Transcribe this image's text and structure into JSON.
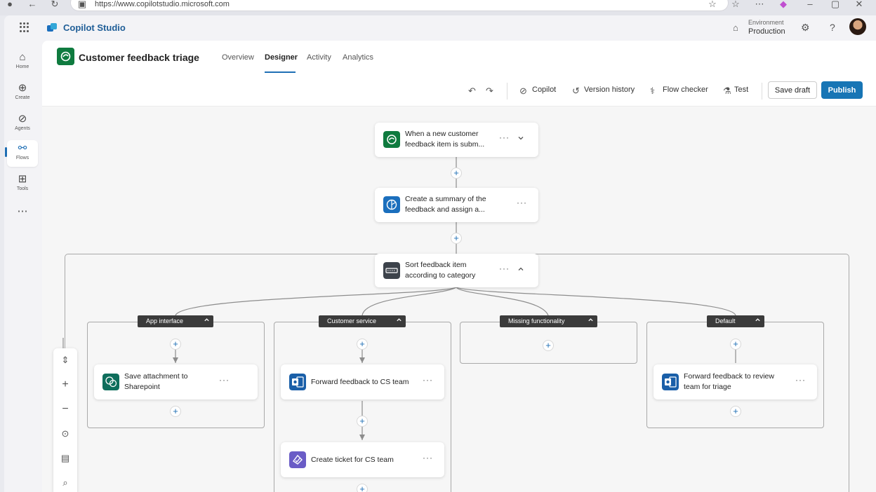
{
  "browser": {
    "url": "https://www.copilotstudio.microsoft.com",
    "icons": [
      "profile-icon",
      "back-icon",
      "refresh-icon",
      "site-info-icon",
      "favorite-add-icon",
      "favorites-icon",
      "more-icon",
      "copilot-icon",
      "minimize-icon",
      "maximize-icon",
      "close-icon"
    ]
  },
  "app": {
    "name": "Copilot Studio",
    "environment_label": "Environment",
    "environment_value": "Production"
  },
  "rail": {
    "items": [
      {
        "label": "Home",
        "icon": "home-icon"
      },
      {
        "label": "Create",
        "icon": "create-icon"
      },
      {
        "label": "Agents",
        "icon": "agents-icon"
      },
      {
        "label": "Flows",
        "icon": "flows-icon",
        "active": true
      },
      {
        "label": "Tools",
        "icon": "tools-icon"
      }
    ],
    "more": "⋯"
  },
  "flow": {
    "title": "Customer feedback triage",
    "tabs": [
      "Overview",
      "Designer",
      "Activity",
      "Analytics"
    ],
    "active_tab": "Designer"
  },
  "toolbar": {
    "copilot": "Copilot",
    "version_history": "Version history",
    "flow_checker": "Flow checker",
    "test": "Test",
    "save_draft": "Save draft",
    "publish": "Publish",
    "accent": "#1775b5"
  },
  "nodes": {
    "trigger": {
      "line1": "When a new customer",
      "line2": "feedback item is subm...",
      "color": "#0f7b3f"
    },
    "summary": {
      "line1": "Create a summary of the",
      "line2": "feedback and assign a...",
      "color": "#1b6fbd"
    },
    "sort": {
      "line1": "Sort feedback item",
      "line2": "according to category",
      "color": "#3d434b"
    }
  },
  "branches": [
    {
      "name": "App interface",
      "actions": [
        {
          "line1": "Save attachment to",
          "line2": "Sharepoint",
          "color": "#0e6e5c"
        }
      ]
    },
    {
      "name": "Customer service",
      "actions": [
        {
          "line1": "Forward feedback to CS team",
          "color": "#1a5fa8"
        },
        {
          "line1": "Create ticket for CS team",
          "color": "#6a5cc6"
        }
      ]
    },
    {
      "name": "Missing functionality",
      "actions": []
    },
    {
      "name": "Default",
      "actions": [
        {
          "line1": "Forward feedback to review",
          "line2": "team for triage",
          "color": "#1a5fa8"
        }
      ]
    }
  ],
  "glyphs": {
    "more": "···",
    "plus": "+",
    "chevron_down": "⌄",
    "chevron_up": "⌃"
  }
}
